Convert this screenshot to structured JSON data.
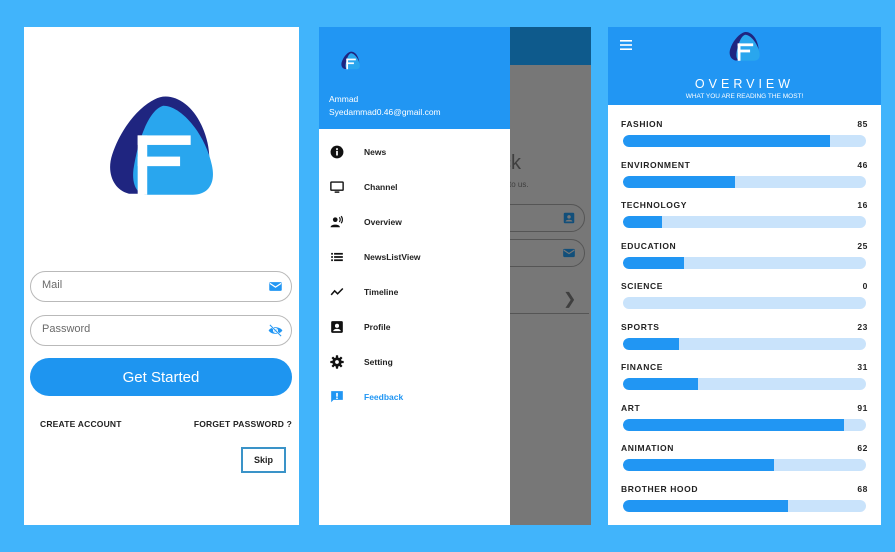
{
  "colors": {
    "background": "#41b4fb",
    "primary": "#2196f3",
    "logo_dark": "#1f2580",
    "logo_light": "#29a6ee",
    "track": "#c9e3fb"
  },
  "login": {
    "mail_placeholder": "Mail",
    "password_placeholder": "Password",
    "get_started_label": "Get Started",
    "create_account_label": "CREATE ACCOUNT",
    "forget_password_label": "FORGET PASSWORD ?",
    "skip_label": "Skip",
    "icons": {
      "mail": "mail-icon",
      "password": "eye-off-icon"
    }
  },
  "drawer": {
    "user_name": "Ammad",
    "user_email": "Syedammad0.46@gmail.com",
    "background_title_fragment": "ck",
    "background_subtitle_fragment": "to us.",
    "items": [
      {
        "label": "News",
        "icon": "info-icon"
      },
      {
        "label": "Channel",
        "icon": "tv-icon"
      },
      {
        "label": "Overview",
        "icon": "record-voice-icon"
      },
      {
        "label": "NewsListView",
        "icon": "list-icon"
      },
      {
        "label": "Timeline",
        "icon": "timeline-icon"
      },
      {
        "label": "Profile",
        "icon": "profile-card-icon"
      },
      {
        "label": "Setting",
        "icon": "gear-icon"
      },
      {
        "label": "Feedback",
        "icon": "feedback-icon",
        "active": true
      }
    ]
  },
  "overview": {
    "title": "OVERVIEW",
    "subtitle": "WHAT YOU ARE READING THE MOST!",
    "categories": [
      {
        "name": "FASHION",
        "value": "85",
        "progress": 0.85
      },
      {
        "name": "ENVIRONMENT",
        "value": "46",
        "progress": 0.46
      },
      {
        "name": "TECHNOLOGY",
        "value": "16",
        "progress": 0.16
      },
      {
        "name": "EDUCATION",
        "value": "25",
        "progress": 0.25
      },
      {
        "name": "SCIENCE",
        "value": "0",
        "progress": 0.0
      },
      {
        "name": "SPORTS",
        "value": "23",
        "progress": 0.23
      },
      {
        "name": "FINANCE",
        "value": "31",
        "progress": 0.31
      },
      {
        "name": "ART",
        "value": "91",
        "progress": 0.91
      },
      {
        "name": "ANIMATION",
        "value": "62",
        "progress": 0.62
      },
      {
        "name": "BROTHER HOOD",
        "value": "68",
        "progress": 0.68
      }
    ]
  }
}
